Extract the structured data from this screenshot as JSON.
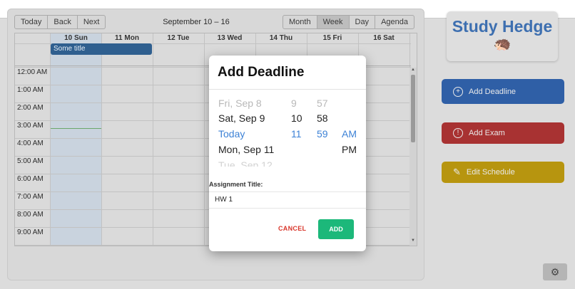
{
  "toolbar": {
    "nav": [
      "Today",
      "Back",
      "Next"
    ],
    "range": "September 10 – 16",
    "views": [
      "Month",
      "Week",
      "Day",
      "Agenda"
    ],
    "active_view": "Week"
  },
  "calendar": {
    "days": [
      "10 Sun",
      "11 Mon",
      "12 Tue",
      "13 Wed",
      "14 Thu",
      "15 Fri",
      "16 Sat"
    ],
    "event": "Some title",
    "times": [
      "12:00 AM",
      "1:00 AM",
      "2:00 AM",
      "3:00 AM",
      "4:00 AM",
      "5:00 AM",
      "6:00 AM",
      "7:00 AM",
      "8:00 AM",
      "9:00 AM"
    ]
  },
  "sidebar": {
    "logo_title": "Study Hedge",
    "logo_icon": "hedgehog-icon",
    "actions": {
      "deadline": "Add Deadline",
      "exam": "Add Exam",
      "schedule": "Edit Schedule"
    },
    "colors": {
      "deadline": "#3a7be0",
      "exam": "#cc3b3b",
      "schedule": "#e0b31b"
    }
  },
  "modal": {
    "title": "Add Deadline",
    "picker": {
      "rows": [
        [
          "Fri, Sep 8",
          "9",
          "57",
          ""
        ],
        [
          "Sat, Sep 9",
          "10",
          "58",
          ""
        ],
        [
          "Today",
          "11",
          "59",
          "AM"
        ],
        [
          "Mon, Sep 11",
          "",
          "",
          "PM"
        ],
        [
          "Tue, Sep 12",
          "",
          "",
          ""
        ]
      ]
    },
    "field_label": "Assignment Title:",
    "field_value": "HW 1",
    "cancel": "CANCEL",
    "add": "ADD",
    "add_color": "#1cb87a",
    "accent": "#3d82d6"
  }
}
